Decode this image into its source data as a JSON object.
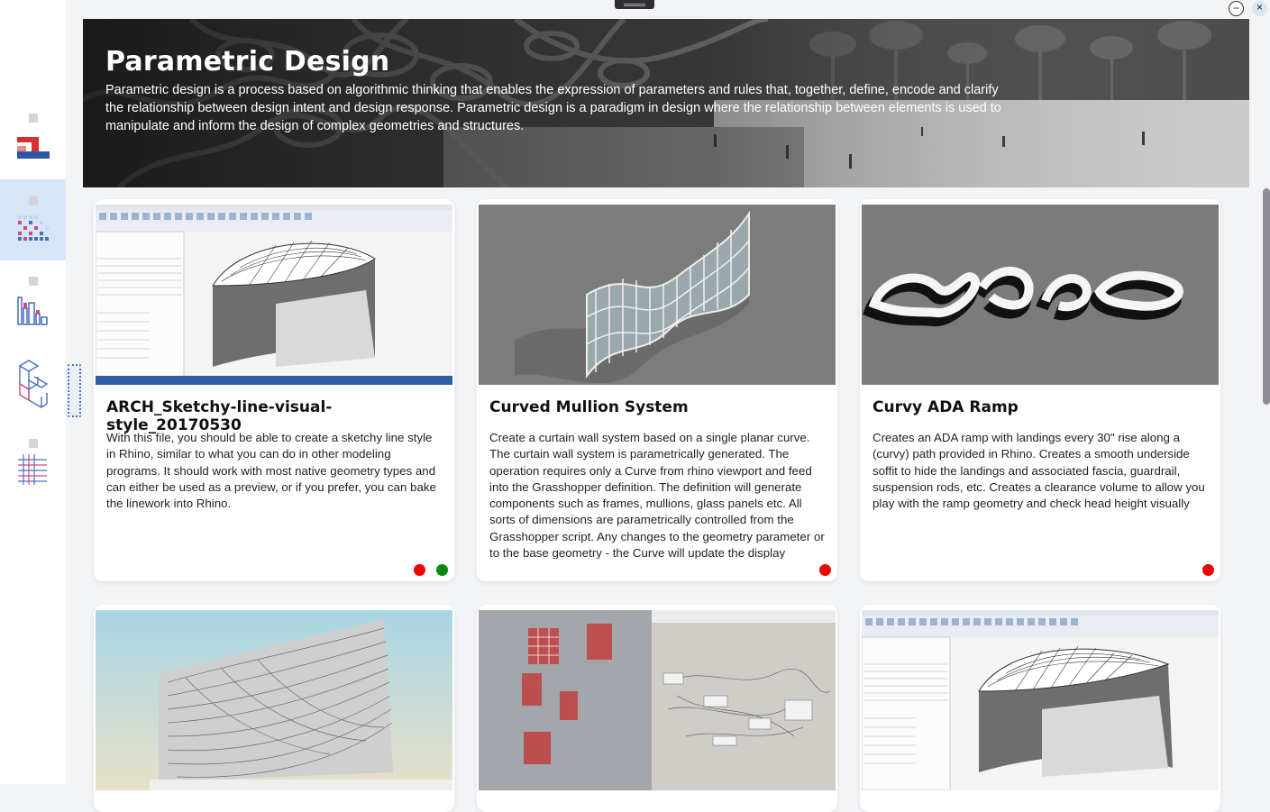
{
  "window": {
    "minimize_glyph": "−",
    "close_glyph": "×"
  },
  "sidebar": {
    "items": [
      {
        "icon": "library-logo-icon",
        "active": false
      },
      {
        "icon": "grid-dots-icon",
        "active": true
      },
      {
        "icon": "bar-chart-icon",
        "active": false
      },
      {
        "icon": "isometric-blocks-icon",
        "active": false
      },
      {
        "icon": "grid-lines-icon",
        "active": false
      }
    ]
  },
  "banner": {
    "title": "Parametric Design",
    "description": " Parametric design is a process based on algorithmic thinking that enables the expression of parameters and rules that, together, define, encode and clarify the relationship between design intent and design response. Parametric design is a paradigm in design where the relationship between elements is used to manipulate and inform the design of complex geometries and structures."
  },
  "cards": [
    {
      "title": "ARCH_Sketchy-line-visual-style_20170530",
      "description": " With this file, you should be able to create a sketchy line style in Rhino, similar to what you can do in other modeling programs. It should work with most native geometry types and can either be used as a preview, or if you prefer, you can bake the linework into Rhino.",
      "thumb": "revit-dome-screenshot",
      "status": [
        "#f20000",
        "#0a8a0a"
      ]
    },
    {
      "title": "Curved Mullion System",
      "description": " Create a curtain wall system based on a single planar curve. The curtain wall system is parametrically generated. The operation requires only a Curve from rhino viewport and feed into the Grasshopper definition. The definition will generate components such as frames, mullions, glass panels etc. All sorts of dimensions are parametrically controlled from the Grasshopper script. Any changes to the geometry parameter or to the base geometry - the Curve will update the display",
      "thumb": "curtain-wall-render",
      "status": [
        "#f20000"
      ]
    },
    {
      "title": "Curvy ADA Ramp",
      "description": " Creates an ADA ramp with landings every 30\" rise along a (curvy) path provided in Rhino. Creates a smooth underside soffit to hide the landings and associated fascia, guardrail, suspension rods, etc. Creates a clearance volume to allow you play with the ramp geometry and check head height visually",
      "thumb": "curvy-ramp-render",
      "status": [
        "#f20000"
      ]
    },
    {
      "title": "",
      "description": "",
      "thumb": "facade-sky-render",
      "status": []
    },
    {
      "title": "",
      "description": "",
      "thumb": "grasshopper-screenshot",
      "status": []
    },
    {
      "title": "",
      "description": "",
      "thumb": "revit-dome-screenshot",
      "status": []
    }
  ]
}
